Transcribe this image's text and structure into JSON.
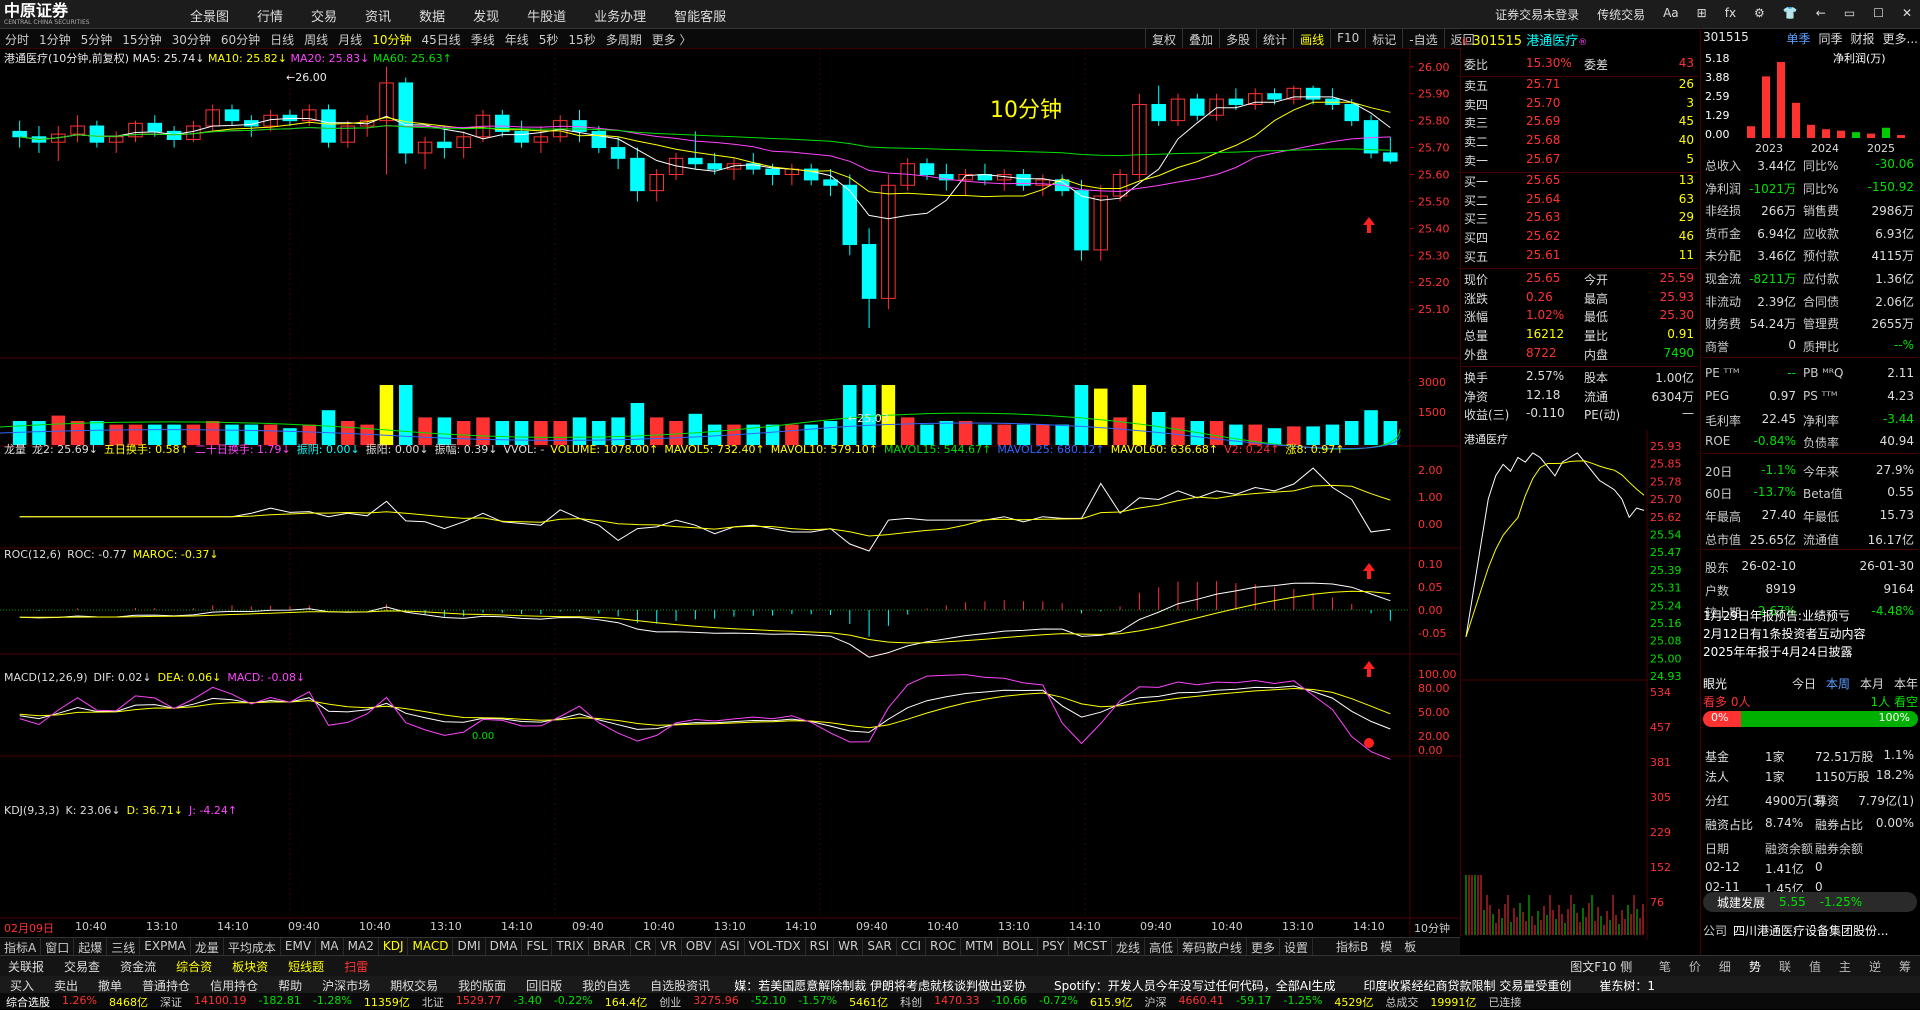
{
  "menu": {
    "brand": "中原证券",
    "brand_sub": "CENTRAL CHINA SECURITIES",
    "items": [
      "全景图",
      "行情",
      "交易",
      "资讯",
      "数据",
      "发现",
      "牛股道",
      "业务办理",
      "智能客服"
    ],
    "right": [
      "证券交易未登录",
      "传统交易",
      "Aa",
      "⊞",
      "fx",
      "⚙",
      "👕",
      "←",
      "▭",
      "☐",
      "✕"
    ]
  },
  "periods": [
    "分时",
    "1分钟",
    "5分钟",
    "15分钟",
    "30分钟",
    "60分钟",
    "日线",
    "周线",
    "月线",
    "10分钟",
    "45日线",
    "季线",
    "年线",
    "5秒",
    "15秒",
    "多周期",
    "更多 〉"
  ],
  "active_period": "10分钟",
  "tools": [
    "复权",
    "叠加",
    "多股",
    "统计",
    "画线",
    "F10",
    "标记",
    "-自选",
    "返回"
  ],
  "active_tool": "画线",
  "chart_header": {
    "stock": "港通医疗(10分钟,前复权)",
    "ma5": "MA5: 25.74↓",
    "ma10": "MA10: 25.82↓",
    "ma20": "MA20: 25.83↓",
    "ma60": "MA60: 25.63↑",
    "period_label": "10分钟",
    "high_mark": "26.00",
    "low_mark": "25.03"
  },
  "price_axis": [
    "26.00",
    "25.90",
    "25.80",
    "25.70",
    "25.60",
    "25.50",
    "25.40",
    "25.30",
    "25.20",
    "25.10"
  ],
  "vol_header": [
    "龙量",
    "龙2: 25.69↓",
    "五日换手: 0.58↑",
    "二十日换手: 1.79↓",
    "振阴: 0.00↓",
    "振阳: 0.00↓",
    "振幅: 0.39↓",
    "VVOL: -",
    "VOLUME: 1078.00↑",
    "MAVOL5: 732.40↑",
    "MAVOL10: 579.10↑",
    "MAVOL15: 544.67↑",
    "MAVOL25: 680.12↑",
    "MAVOL60: 636.68↑",
    "V2: 0.24↑",
    "涨8: 0.97↑"
  ],
  "vol_axis": [
    "3000",
    "1500"
  ],
  "roc_header": [
    "ROC(12,6)",
    "ROC: -0.77",
    "MAROC: -0.37↓"
  ],
  "roc_axis": [
    "2.00",
    "1.00",
    "0.00"
  ],
  "macd_header": [
    "MACD(12,26,9)",
    "DIF: 0.02↓",
    "DEA: 0.06↓",
    "MACD: -0.08↓"
  ],
  "macd_axis": [
    "0.10",
    "0.05",
    "0.00",
    "-0.05"
  ],
  "macd_zero_label": "0.00",
  "kdj_header": [
    "KDJ(9,3,3)",
    "K: 23.06↓",
    "D: 36.71↓",
    "J: -4.24↑"
  ],
  "kdj_axis": [
    "100.00",
    "80.00",
    "50.00",
    "20.00",
    "0.00"
  ],
  "time_axis": [
    "02月09日",
    "10:40",
    "13:10",
    "14:10",
    "09:40",
    "10:40",
    "13:10",
    "14:10",
    "09:40",
    "10:40",
    "13:10",
    "14:10",
    "09:40",
    "10:40",
    "13:10",
    "14:10",
    "09:40",
    "10:40",
    "13:10",
    "14:10"
  ],
  "time_unit": "10分钟",
  "bottom_tabs": [
    "指标A",
    "窗口",
    "起爆",
    "三线",
    "EXPMA",
    "龙量",
    "平均成本",
    "EMV",
    "MA",
    "MA2",
    "KDJ",
    "MACD",
    "DMI",
    "DMA",
    "FSL",
    "TRIX",
    "BRAR",
    "CR",
    "VR",
    "OBV",
    "ASI",
    "VOL-TDX",
    "RSI",
    "WR",
    "SAR",
    "CCI",
    "ROC",
    "MTM",
    "BOLL",
    "PSY",
    "MCST",
    "龙线",
    "高低",
    "筹码散户线",
    "更多",
    "设置"
  ],
  "bottom_tabs_right": [
    "指标B",
    "模",
    "板"
  ],
  "bar2": [
    {
      "t": "关联报价",
      "c": "white"
    },
    {
      "t": "交易查询",
      "c": "white"
    },
    {
      "t": "资金流向",
      "c": "white"
    },
    {
      "t": "综合资讯",
      "c": "yellow"
    },
    {
      "t": "板块资讯",
      "c": "yellow"
    },
    {
      "t": "短线题因",
      "c": "yellow"
    },
    {
      "t": "扫雷宝",
      "c": "red"
    }
  ],
  "bar2_mid": "图文F10 侧边栏",
  "bar2_right": [
    "笔",
    "价",
    "细",
    "势",
    "联",
    "值",
    "主",
    "逆",
    "筹"
  ],
  "bar3": [
    "买入",
    "卖出",
    "撤单",
    "普通持仓",
    "信用持仓",
    "帮助",
    "沪深市场",
    "期权交易",
    "我的版面",
    "回旧版",
    "我的自选",
    "自选股资讯"
  ],
  "bar3_news": [
    "媒：若美国愿意解除制裁 伊朗将考虑就核谈判做出妥协",
    "Spotify：开发人员今年没写过任何代码，全部AI生成",
    "印度收紧经纪商贷款限制 交易量受重创",
    "崔东树：1"
  ],
  "bar4": [
    "综合选股",
    "1.26%",
    "8468亿",
    "深证",
    "14100.19",
    "-182.81",
    "-1.28%",
    "11359亿",
    "北证",
    "1529.77",
    "-3.40",
    "-0.22%",
    "164.4亿",
    "创业",
    "3275.96",
    "-52.10",
    "-1.57%",
    "5461亿",
    "科创",
    "1470.33",
    "-10.66",
    "-0.72%",
    "615.9亿",
    "沪深",
    "4660.41",
    "-59.17",
    "-1.25%",
    "4529亿",
    "总成交",
    "19991亿",
    "已连接"
  ],
  "quote": {
    "code": "301515",
    "name": "港通医疗",
    "weibi_label": "委比",
    "weibi": "15.30%",
    "weicha_label": "委差",
    "weicha": "43",
    "asks": [
      {
        "label": "卖五",
        "price": "25.71",
        "vol": "26"
      },
      {
        "label": "卖四",
        "price": "25.70",
        "vol": "3"
      },
      {
        "label": "卖三",
        "price": "25.69",
        "vol": "45"
      },
      {
        "label": "卖二",
        "price": "25.68",
        "vol": "40"
      },
      {
        "label": "卖一",
        "price": "25.67",
        "vol": "5"
      }
    ],
    "bids": [
      {
        "label": "买一",
        "price": "25.65",
        "vol": "13"
      },
      {
        "label": "买二",
        "price": "25.64",
        "vol": "63"
      },
      {
        "label": "买三",
        "price": "25.63",
        "vol": "29"
      },
      {
        "label": "买四",
        "price": "25.62",
        "vol": "46"
      },
      {
        "label": "买五",
        "price": "25.61",
        "vol": "11"
      }
    ],
    "stats": [
      [
        "现价",
        "25.65",
        "今开",
        "25.59"
      ],
      [
        "涨跌",
        "0.26",
        "最高",
        "25.93"
      ],
      [
        "涨幅",
        "1.02%",
        "最低",
        "25.30"
      ],
      [
        "总量",
        "16212",
        "量比",
        "0.91"
      ],
      [
        "外盘",
        "8722",
        "内盘",
        "7490"
      ]
    ],
    "stats2": [
      [
        "换手",
        "2.57%",
        "股本",
        "1.00亿"
      ],
      [
        "净资",
        "12.18",
        "流通",
        "6304万"
      ],
      [
        "收益(三)",
        "-0.110",
        "PE(动)",
        "—"
      ]
    ],
    "intraday_title": "港通医疗",
    "intraday_axis": [
      "25.93",
      "25.85",
      "25.78",
      "25.70",
      "25.62",
      "25.54",
      "25.47",
      "25.39",
      "25.31",
      "25.24",
      "25.16",
      "25.08",
      "25.00",
      "24.93",
      "534",
      "457",
      "381",
      "305",
      "229",
      "152",
      "76"
    ]
  },
  "fin": {
    "code": "301515",
    "tabs": [
      "单季",
      "同季",
      "财报",
      "更多..."
    ],
    "active_tab": "单季",
    "chart_axis": [
      "5.18",
      "3.88",
      "2.59",
      "1.29",
      "0.00"
    ],
    "chart_label": "净利润(万)",
    "years": [
      "2023",
      "2024",
      "2025"
    ],
    "bars": [
      {
        "v": 0.8,
        "c": "#ff3232"
      },
      {
        "v": 4.2,
        "c": "#ff3232"
      },
      {
        "v": 5.18,
        "c": "#ff3232"
      },
      {
        "v": 2.4,
        "c": "#ff3232"
      },
      {
        "v": 0.9,
        "c": "#ff3232"
      },
      {
        "v": 0.6,
        "c": "#ff3232"
      },
      {
        "v": 0.5,
        "c": "#ff3232"
      },
      {
        "v": 0.4,
        "c": "#00cc00"
      },
      {
        "v": 0.3,
        "c": "#ff3232"
      },
      {
        "v": 0.7,
        "c": "#00cc00"
      },
      {
        "v": 0.2,
        "c": "#ff3232"
      }
    ],
    "rows": [
      [
        "总收入",
        "3.44亿",
        "同比%",
        "-30.06"
      ],
      [
        "净利润",
        "-1021万",
        "同比%",
        "-150.92"
      ],
      [
        "非经损",
        "266万",
        "销售费",
        "2986万"
      ],
      [
        "货币金",
        "6.94亿",
        "应收款",
        "6.93亿"
      ],
      [
        "未分配",
        "3.46亿",
        "预付款",
        "4115万"
      ],
      [
        "现金流",
        "-8211万",
        "应付款",
        "1.36亿"
      ],
      [
        "非流动",
        "2.39亿",
        "合同债",
        "2.06亿"
      ],
      [
        "财务费",
        "54.24万",
        "管理费",
        "2655万"
      ],
      [
        "商誉",
        "0",
        "质押比",
        "--%"
      ],
      [
        "PE ᵀᵀᴹ",
        "--",
        "PB ᴹᴿQ",
        "2.11"
      ],
      [
        "PEG",
        "0.97",
        "PS ᵀᵀᴹ",
        "4.23"
      ],
      [
        "毛利率",
        "22.45",
        "净利率",
        "-3.44"
      ],
      [
        "ROE",
        "-0.84%",
        "负债率",
        "40.94"
      ],
      [
        "20日",
        "-1.1%",
        "今年来",
        "27.9%"
      ],
      [
        "60日",
        "-13.7%",
        "Beta值",
        "0.55"
      ],
      [
        "年最高",
        "27.40",
        "年最低",
        "15.73"
      ],
      [
        "总市值",
        "25.65亿",
        "流通值",
        "16.17亿"
      ],
      [
        "股东",
        "26-02-10",
        "",
        "26-01-30"
      ],
      [
        "户数",
        "8919",
        "",
        "9164"
      ],
      [
        "较上期",
        "-2.67%",
        "",
        "-4.48%"
      ]
    ],
    "news": [
      "1月29日年报预告:业绩预亏",
      "2月12日有1条投资者互动内容",
      "2025年年报于4月24日披露"
    ],
    "eye": {
      "label": "眼光",
      "tabs": [
        "今日",
        "本周",
        "本月",
        "本年"
      ],
      "active": "本周",
      "bull_label": "看多",
      "bull_n": "0人",
      "bear_n": "1人",
      "bear_label": "看空",
      "bull_pct": "0%",
      "bear_pct": "100%"
    },
    "holders": [
      [
        "基金",
        "1家",
        "72.51万股",
        "1.1%"
      ],
      [
        "法人",
        "1家",
        "1150万股",
        "18.2%"
      ]
    ],
    "dividend": [
      "分红",
      "4900万(3)",
      "募资",
      "7.79亿(1)"
    ],
    "margin": [
      "融资占比",
      "8.74%",
      "融券占比",
      "0.00%"
    ],
    "margin_table": {
      "head": [
        "日期",
        "融资余额",
        "融券余额"
      ],
      "rows": [
        [
          "02-12",
          "1.41亿",
          "0"
        ],
        [
          "02-11",
          "1.45亿",
          "0"
        ]
      ]
    },
    "sector": {
      "name": "城建发展",
      "price": "5.55",
      "chg": "-1.25%"
    },
    "company": [
      "公司",
      "四川港通医疗设备集团股份..."
    ]
  },
  "chart_data": [
    {
      "type": "candlestick",
      "title": "港通医疗(10分钟,前复权)",
      "ylim": [
        25.03,
        26.04
      ],
      "annotations": [
        "26.00",
        "25.03",
        "10分钟"
      ],
      "ohlc": [
        [
          25.76,
          25.8,
          25.7,
          25.74
        ],
        [
          25.74,
          25.78,
          25.68,
          25.72
        ],
        [
          25.72,
          25.78,
          25.65,
          25.75
        ],
        [
          25.75,
          25.82,
          25.72,
          25.78
        ],
        [
          25.78,
          25.8,
          25.7,
          25.72
        ],
        [
          25.72,
          25.76,
          25.68,
          25.74
        ],
        [
          25.74,
          25.8,
          25.72,
          25.79
        ],
        [
          25.79,
          25.82,
          25.74,
          25.76
        ],
        [
          25.76,
          25.78,
          25.7,
          25.73
        ],
        [
          25.73,
          25.8,
          25.72,
          25.78
        ],
        [
          25.78,
          25.86,
          25.76,
          25.84
        ],
        [
          25.84,
          25.86,
          25.78,
          25.8
        ],
        [
          25.8,
          25.82,
          25.74,
          25.78
        ],
        [
          25.78,
          25.84,
          25.76,
          25.82
        ],
        [
          25.82,
          25.84,
          25.78,
          25.8
        ],
        [
          25.8,
          25.86,
          25.78,
          25.84
        ],
        [
          25.84,
          25.86,
          25.7,
          25.72
        ],
        [
          25.72,
          25.8,
          25.7,
          25.78
        ],
        [
          25.78,
          25.82,
          25.74,
          25.8
        ],
        [
          25.8,
          26.0,
          25.6,
          25.94
        ],
        [
          25.94,
          25.96,
          25.64,
          25.68
        ],
        [
          25.68,
          25.74,
          25.62,
          25.72
        ],
        [
          25.72,
          25.78,
          25.66,
          25.7
        ],
        [
          25.7,
          25.76,
          25.66,
          25.74
        ],
        [
          25.74,
          25.84,
          25.72,
          25.82
        ],
        [
          25.82,
          25.84,
          25.74,
          25.76
        ],
        [
          25.76,
          25.8,
          25.7,
          25.72
        ],
        [
          25.72,
          25.78,
          25.68,
          25.74
        ],
        [
          25.74,
          25.82,
          25.72,
          25.8
        ],
        [
          25.8,
          25.84,
          25.72,
          25.76
        ],
        [
          25.76,
          25.78,
          25.68,
          25.7
        ],
        [
          25.7,
          25.74,
          25.62,
          25.66
        ],
        [
          25.66,
          25.7,
          25.5,
          25.54
        ],
        [
          25.54,
          25.62,
          25.5,
          25.6
        ],
        [
          25.6,
          25.68,
          25.58,
          25.66
        ],
        [
          25.66,
          25.76,
          25.62,
          25.64
        ],
        [
          25.64,
          25.68,
          25.6,
          25.62
        ],
        [
          25.62,
          25.66,
          25.58,
          25.64
        ],
        [
          25.64,
          25.68,
          25.6,
          25.62
        ],
        [
          25.62,
          25.64,
          25.56,
          25.6
        ],
        [
          25.6,
          25.64,
          25.56,
          25.62
        ],
        [
          25.62,
          25.64,
          25.56,
          25.58
        ],
        [
          25.58,
          25.62,
          25.52,
          25.56
        ],
        [
          25.56,
          25.6,
          25.3,
          25.34
        ],
        [
          25.34,
          25.4,
          25.03,
          25.14
        ],
        [
          25.14,
          25.6,
          25.1,
          25.56
        ],
        [
          25.56,
          25.66,
          25.54,
          25.64
        ],
        [
          25.64,
          25.66,
          25.58,
          25.6
        ],
        [
          25.6,
          25.64,
          25.54,
          25.58
        ],
        [
          25.58,
          25.62,
          25.52,
          25.6
        ],
        [
          25.6,
          25.64,
          25.56,
          25.58
        ],
        [
          25.58,
          25.62,
          25.54,
          25.6
        ],
        [
          25.6,
          25.62,
          25.54,
          25.56
        ],
        [
          25.56,
          25.6,
          25.52,
          25.58
        ],
        [
          25.58,
          25.6,
          25.52,
          25.54
        ],
        [
          25.54,
          25.58,
          25.28,
          25.32
        ],
        [
          25.32,
          25.56,
          25.28,
          25.52
        ],
        [
          25.52,
          25.62,
          25.5,
          25.6
        ],
        [
          25.6,
          25.9,
          25.58,
          25.86
        ],
        [
          25.86,
          25.93,
          25.78,
          25.8
        ],
        [
          25.8,
          25.9,
          25.78,
          25.88
        ],
        [
          25.88,
          25.9,
          25.8,
          25.82
        ],
        [
          25.82,
          25.9,
          25.8,
          25.88
        ],
        [
          25.88,
          25.92,
          25.84,
          25.86
        ],
        [
          25.86,
          25.92,
          25.84,
          25.9
        ],
        [
          25.9,
          25.92,
          25.86,
          25.88
        ],
        [
          25.88,
          25.93,
          25.86,
          25.92
        ],
        [
          25.92,
          25.93,
          25.86,
          25.88
        ],
        [
          25.88,
          25.92,
          25.84,
          25.86
        ],
        [
          25.86,
          25.88,
          25.78,
          25.8
        ],
        [
          25.8,
          25.82,
          25.66,
          25.68
        ],
        [
          25.68,
          25.74,
          25.64,
          25.65
        ]
      ]
    },
    {
      "type": "line",
      "title": "港通医疗",
      "ylim": [
        24.93,
        25.93
      ],
      "series": [
        {
          "values": [
            25.1,
            25.3,
            25.5,
            25.7,
            25.8,
            25.85,
            25.82,
            25.88,
            25.86,
            25.9,
            25.88,
            25.84,
            25.8,
            25.86,
            25.88,
            25.9,
            25.86,
            25.82,
            25.78,
            25.76,
            25.74,
            25.7,
            25.62,
            25.66,
            25.65
          ]
        }
      ]
    }
  ]
}
